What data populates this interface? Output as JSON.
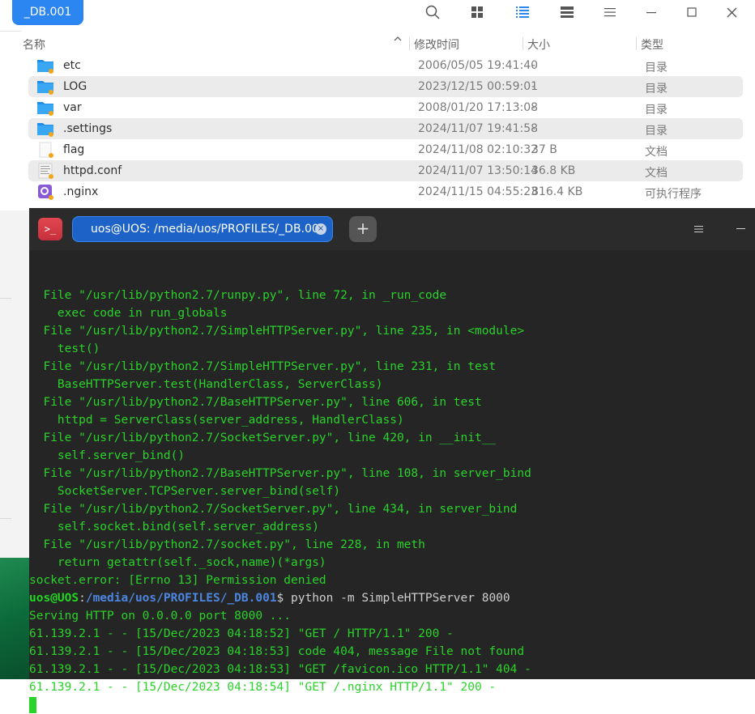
{
  "file_manager": {
    "tab_title": "_DB.001",
    "toolbar": {
      "search": "search-icon",
      "icon_view": "grid-icon",
      "list_view": "list-icon",
      "tree_view": "tree-icon",
      "menu": "menu-icon",
      "minimize": "minimize-icon",
      "maximize": "maximize-icon",
      "close": "close-icon"
    },
    "columns": {
      "name": "名称",
      "modified": "修改时间",
      "size": "大小",
      "type": "类型"
    },
    "files": [
      {
        "name": "etc",
        "modified": "2006/05/05 19:41:40",
        "size": "-",
        "type": "目录",
        "icon": "folder-icon"
      },
      {
        "name": "LOG",
        "modified": "2023/12/15 00:59:01",
        "size": "-",
        "type": "目录",
        "icon": "folder-icon"
      },
      {
        "name": "var",
        "modified": "2008/01/20 17:13:08",
        "size": "-",
        "type": "目录",
        "icon": "folder-icon"
      },
      {
        "name": ".settings",
        "modified": "2024/11/07 19:41:58",
        "size": "-",
        "type": "目录",
        "icon": "folder-icon"
      },
      {
        "name": "flag",
        "modified": "2024/11/08 02:10:32",
        "size": "37 B",
        "type": "文档",
        "icon": "document-icon"
      },
      {
        "name": "httpd.conf",
        "modified": "2024/11/07 13:50:14",
        "size": "36.8 KB",
        "type": "文档",
        "icon": "text-document-icon"
      },
      {
        "name": ".nginx",
        "modified": "2024/11/15 04:55:23",
        "size": "816.4 KB",
        "type": "可执行程序",
        "icon": "executable-icon"
      }
    ]
  },
  "terminal": {
    "logo": ">_",
    "tab_title": "uos@UOS: /media/uos/PROFILES/_DB.001",
    "tab_close": "×",
    "add_tab": "+",
    "menu": "☰",
    "lines": [
      "  File \"/usr/lib/python2.7/runpy.py\", line 72, in _run_code",
      "    exec code in run_globals",
      "  File \"/usr/lib/python2.7/SimpleHTTPServer.py\", line 235, in <module>",
      "    test()",
      "  File \"/usr/lib/python2.7/SimpleHTTPServer.py\", line 231, in test",
      "    BaseHTTPServer.test(HandlerClass, ServerClass)",
      "  File \"/usr/lib/python2.7/BaseHTTPServer.py\", line 606, in test",
      "    httpd = ServerClass(server_address, HandlerClass)",
      "  File \"/usr/lib/python2.7/SocketServer.py\", line 420, in __init__",
      "    self.server_bind()",
      "  File \"/usr/lib/python2.7/BaseHTTPServer.py\", line 108, in server_bind",
      "    SocketServer.TCPServer.server_bind(self)",
      "  File \"/usr/lib/python2.7/SocketServer.py\", line 434, in server_bind",
      "    self.socket.bind(self.server_address)",
      "  File \"/usr/lib/python2.7/socket.py\", line 228, in meth",
      "    return getattr(self._sock,name)(*args)",
      "socket.error: [Errno 13] Permission denied"
    ],
    "prompt": {
      "user": "uos@UOS",
      "sep": ":",
      "path": "/media/uos/PROFILES/_DB.001",
      "symbol": "$ ",
      "command": "python -m SimpleHTTPServer 8000"
    },
    "output": [
      "Serving HTTP on 0.0.0.0 port 8000 ...",
      "61.139.2.1 - - [15/Dec/2023 04:18:52] \"GET / HTTP/1.1\" 200 -",
      "61.139.2.1 - - [15/Dec/2023 04:18:53] code 404, message File not found",
      "61.139.2.1 - - [15/Dec/2023 04:18:53] \"GET /favicon.ico HTTP/1.1\" 404 -",
      "61.139.2.1 - - [15/Dec/2023 04:18:54] \"GET /.nginx HTTP/1.1\" 200 -"
    ]
  }
}
